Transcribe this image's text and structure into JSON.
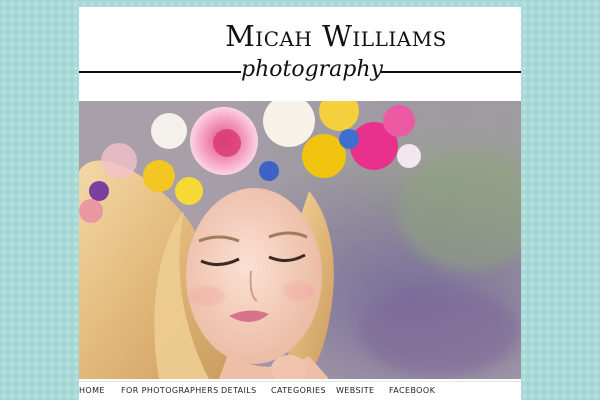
{
  "header": {
    "title": "Micah Williams",
    "tagline": "photography"
  },
  "hero": {
    "icon": "hero-photo"
  },
  "nav": {
    "items": [
      {
        "label": "HOME"
      },
      {
        "label": "FOR PHOTOGRAPHERS"
      },
      {
        "label": "DETAILS"
      },
      {
        "label": "CATEGORIES"
      },
      {
        "label": "WEBSITE"
      },
      {
        "label": "FACEBOOK"
      }
    ]
  },
  "colors": {
    "background": "#a9dad7",
    "page": "#ffffff",
    "text": "#111111"
  }
}
